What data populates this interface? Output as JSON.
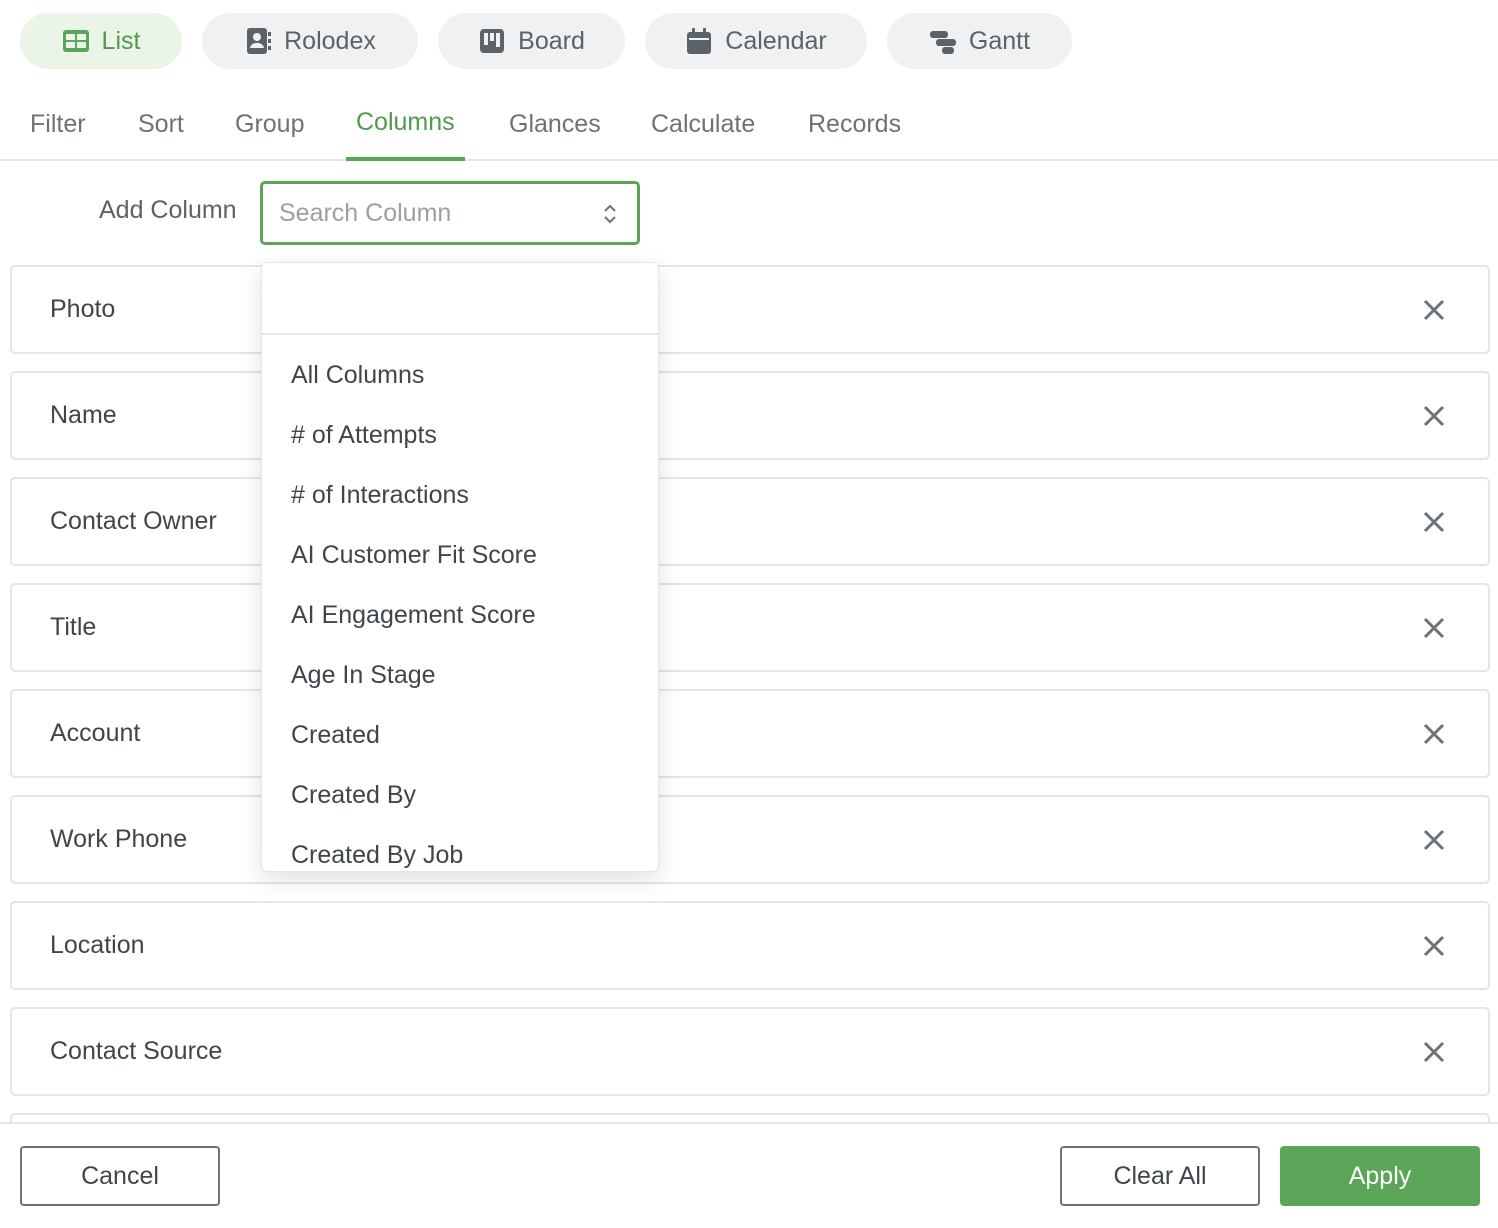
{
  "views": [
    {
      "label": "List",
      "icon": "list-view-icon",
      "active": true
    },
    {
      "label": "Rolodex",
      "icon": "rolodex-icon",
      "active": false
    },
    {
      "label": "Board",
      "icon": "board-icon",
      "active": false
    },
    {
      "label": "Calendar",
      "icon": "calendar-icon",
      "active": false
    },
    {
      "label": "Gantt",
      "icon": "gantt-icon",
      "active": false
    }
  ],
  "tabs": [
    {
      "label": "Filter"
    },
    {
      "label": "Sort"
    },
    {
      "label": "Group"
    },
    {
      "label": "Columns",
      "active": true
    },
    {
      "label": "Glances"
    },
    {
      "label": "Calculate"
    },
    {
      "label": "Records"
    }
  ],
  "add_column": {
    "label": "Add Column",
    "placeholder": "Search Column"
  },
  "columns": [
    {
      "label": "Photo"
    },
    {
      "label": "Name"
    },
    {
      "label": "Contact Owner"
    },
    {
      "label": "Title"
    },
    {
      "label": "Account"
    },
    {
      "label": "Work Phone"
    },
    {
      "label": "Location"
    },
    {
      "label": "Contact Source"
    }
  ],
  "dropdown": {
    "options": [
      "All Columns",
      "# of Attempts",
      "# of Interactions",
      "AI Customer Fit Score",
      "AI Engagement Score",
      "Age In Stage",
      "Created",
      "Created By",
      "Created By Job"
    ]
  },
  "footer": {
    "cancel": "Cancel",
    "clear_all": "Clear All",
    "apply": "Apply"
  },
  "colors": {
    "accent": "#5aa557",
    "active_pill_bg": "#eaf5e8"
  }
}
